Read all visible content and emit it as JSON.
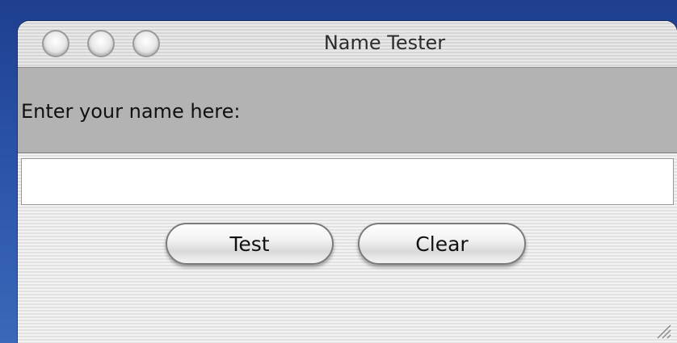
{
  "window": {
    "title": "Name Tester"
  },
  "form": {
    "prompt_label": "Enter your name here:",
    "name_value": "",
    "name_placeholder": ""
  },
  "buttons": {
    "test_label": "Test",
    "clear_label": "Clear"
  },
  "icons": {
    "close": "close-icon",
    "minimize": "minimize-icon",
    "zoom": "zoom-icon",
    "resize": "resize-grip-icon"
  }
}
